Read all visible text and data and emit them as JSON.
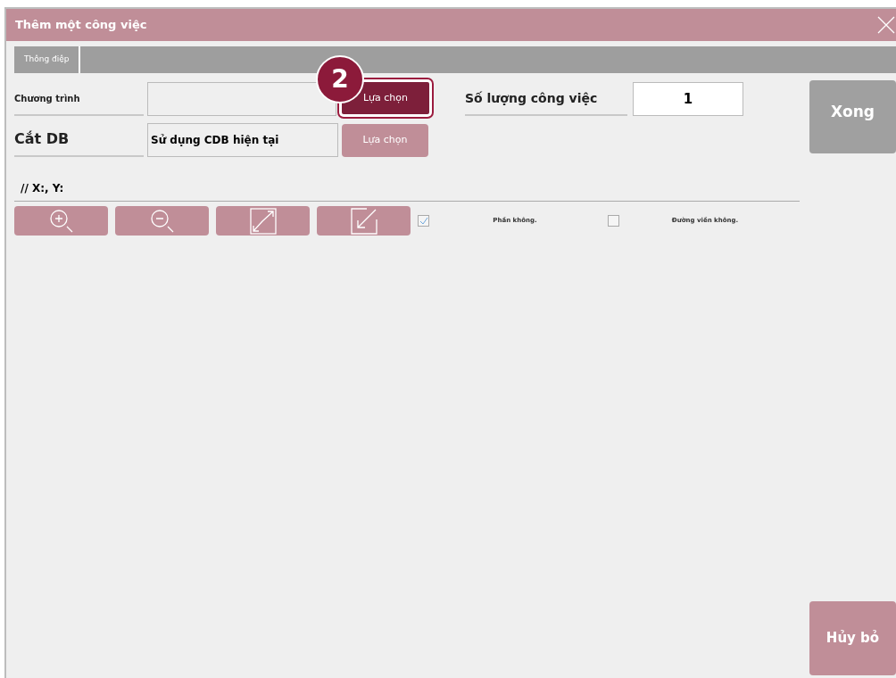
{
  "window": {
    "title": "Thêm một công việc"
  },
  "tabs": [
    {
      "label": "Thông điệp",
      "selected": true
    }
  ],
  "program": {
    "label": "Chương trình",
    "button": "Lựa chọn",
    "highlighted": true,
    "step_badge": "2"
  },
  "cut_db": {
    "label": "Cắt DB",
    "value": "Sử dụng CDB hiện tại",
    "button": "Lựa chọn",
    "highlighted": false
  },
  "job_count": {
    "label": "Số lượng công việc",
    "value": "1"
  },
  "coords": "// X:, Y:",
  "options": [
    {
      "label": "Phần không.",
      "checked": true
    },
    {
      "label": "Đường viền không.",
      "checked": false
    }
  ],
  "buttons": {
    "done": "Xong",
    "cancel": "Hủy bỏ"
  }
}
